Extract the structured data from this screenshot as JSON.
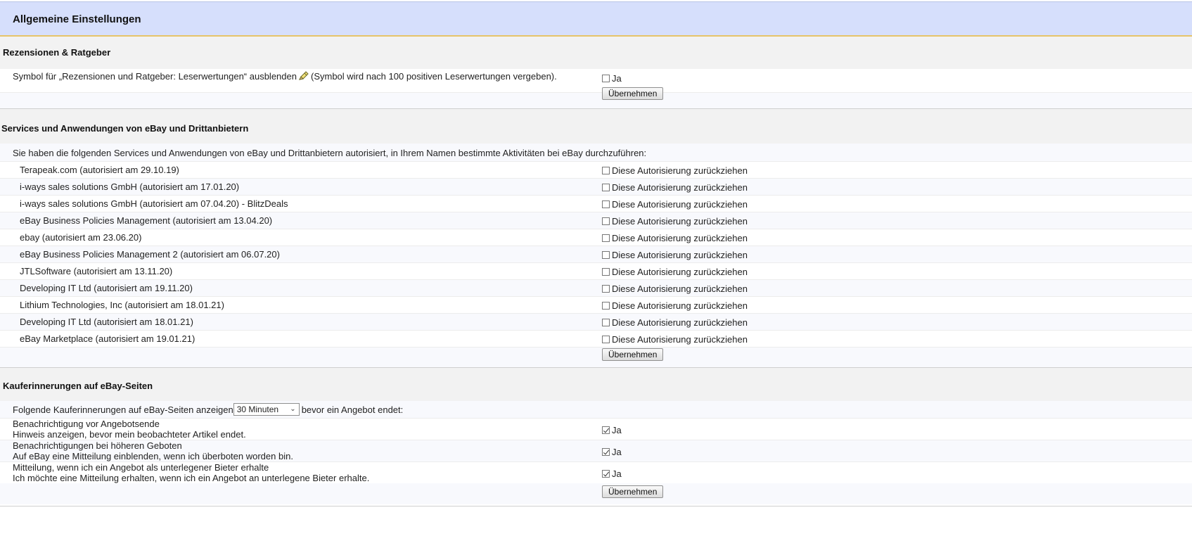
{
  "page": {
    "title": "Allgemeine Einstellungen"
  },
  "reviews": {
    "title": "Rezensionen & Ratgeber",
    "setting_label_a": "Symbol für „Rezensionen und Ratgeber: Leserwertungen“ ausblenden",
    "setting_label_b": "(Symbol wird nach 100 positiven Leserwertungen vergeben).",
    "checkbox_label": "Ja",
    "checked": false,
    "apply_label": "Übernehmen"
  },
  "services": {
    "title": "Services und Anwendungen von eBay und Drittanbietern",
    "intro": "Sie haben die folgenden Services und Anwendungen von eBay und Drittanbietern autorisiert, in Ihrem Namen bestimmte Aktivitäten bei eBay durchzuführen:",
    "revoke_label": "Diese Autorisierung zurückziehen",
    "items": [
      {
        "name": "Terapeak.com (autorisiert am 29.10.19)"
      },
      {
        "name": "i-ways sales solutions GmbH (autorisiert am 17.01.20)"
      },
      {
        "name": "i-ways sales solutions GmbH (autorisiert am 07.04.20) - BlitzDeals"
      },
      {
        "name": "eBay Business Policies Management (autorisiert am 13.04.20)"
      },
      {
        "name": "ebay (autorisiert am 23.06.20)"
      },
      {
        "name": "eBay Business Policies Management 2 (autorisiert am 06.07.20)"
      },
      {
        "name": "JTLSoftware (autorisiert am 13.11.20)"
      },
      {
        "name": "Developing IT Ltd (autorisiert am 19.11.20)"
      },
      {
        "name": "Lithium Technologies, Inc (autorisiert am 18.01.21)"
      },
      {
        "name": "Developing IT Ltd (autorisiert am 18.01.21)"
      },
      {
        "name": "eBay Marketplace (autorisiert am 19.01.21)"
      }
    ],
    "apply_label": "Übernehmen"
  },
  "reminders": {
    "title": "Kauferinnerungen auf eBay-Seiten",
    "intro_before": "Folgende Kauferinnerungen auf eBay-Seiten anzeigen",
    "select_value": "30 Minuten",
    "intro_after": "bevor ein Angebot endet:",
    "checkbox_label": "Ja",
    "items": [
      {
        "title": "Benachrichtigung vor Angebotsende",
        "desc": "Hinweis anzeigen, bevor mein beobachteter Artikel endet.",
        "checked": true
      },
      {
        "title": "Benachrichtigungen bei höheren Geboten",
        "desc": "Auf eBay eine Mitteilung einblenden, wenn ich überboten worden bin.",
        "checked": true
      },
      {
        "title": "Mitteilung, wenn ich ein Angebot als unterlegener Bieter erhalte",
        "desc": "Ich möchte eine Mitteilung erhalten, wenn ich ein Angebot an unterlegene Bieter erhalte.",
        "checked": true
      }
    ],
    "apply_label": "Übernehmen"
  }
}
